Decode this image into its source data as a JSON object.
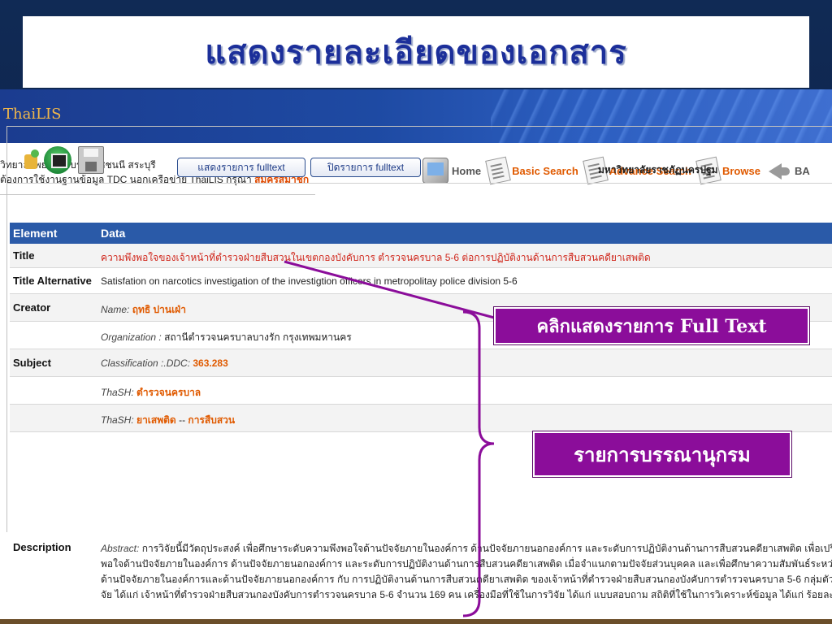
{
  "slide": {
    "title": "แสดงรายละเอียดของเอกสาร"
  },
  "app": {
    "logo": "ThaiLIS",
    "info_line1": "วิทยาลัยพยาบาลบรมราชชนนี สระบุรี",
    "info_line2_prefix": "ต้องการใช้งานฐานข้อมูล TDC นอกเครือข่าย ThaiLIS กรุณา",
    "info_line2_link": "สมัครสมาชิก"
  },
  "nav": {
    "home": "Home",
    "basic_search": "Basic Search",
    "advance_search": "Advance Search",
    "browse": "Browse",
    "back": "BA"
  },
  "toolbar": {
    "show_fulltext": "แสดงรายการ fulltext",
    "close_fulltext": "ปิดรายการ fulltext",
    "university": "มหาวิทยาลัยราชภัฏนครปฐม"
  },
  "table": {
    "col_element": "Element",
    "col_data": "Data",
    "title_label": "Title",
    "title_value": "ความพึงพอใจของเจ้าหน้าที่ตำรวจฝ่ายสืบสวนในเขตกองบังคับการ ตำรวจนครบาล 5-6 ต่อการปฏิบัติงานด้านการสืบสวนคดียาเสพติด",
    "title_alt_label": "Title Alternative",
    "title_alt_value": "Satisfation on narcotics investigation of the investigtion officers in metropolitay police division 5-6",
    "creator_label": "Creator",
    "creator_name_key": "Name:",
    "creator_name_value": "ฤทธิ ปานเฝ่า",
    "creator_org_key": "Organization :",
    "creator_org_value": "สถานีตำรวจนครบาลบางรัก กรุงเทพมหานคร",
    "subject_label": "Subject",
    "subject_class_key": "Classification :.DDC:",
    "subject_class_value": "363.283",
    "subject_thash1_key": "ThaSH:",
    "subject_thash1_value": "ตำรวจนครบาล",
    "subject_thash2_key": "ThaSH:",
    "subject_thash2_value_a": "ยาเสพติด",
    "subject_thash2_sep": "--",
    "subject_thash2_value_b": "การสืบสวน",
    "desc_label": "Description",
    "desc_key": "Abstract:",
    "desc_line1": "การวิจัยนี้มีวัตถุประสงค์ เพื่อศึกษาระดับความพึงพอใจด้านปัจจัยภายในองค์การ ด้านปัจจัยภายนอกองค์การ และระดับการปฏิบัติงานด้านการสืบสวนคดียาเสพติด เพื่อเปรียบเ",
    "desc_line2": "พอใจด้านปัจจัยภายในองค์การ ด้านปัจจัยภายนอกองค์การ และระดับการปฏิบัติงานด้านการสืบสวนคดียาเสพติด เมื่อจำแนกตามปัจจัยส่วนบุคคล และเพื่อศึกษาความสัมพันธ์ระหว่างคว",
    "desc_line3": "ด้านปัจจัยภายในองค์การและด้านปัจจัยภายนอกองค์การ กับ การปฏิบัติงานด้านการสืบสวนคดียาเสพติด ของเจ้าหน้าที่ตำรวจฝ่ายสืบสวนกองบังคับการตำรวจนครบาล 5-6 กลุ่มตัวอย่าง",
    "desc_line4": "จัย ได้แก่ เจ้าหน้าที่ตำรวจฝ่ายสืบสวนกองบังคับการตำรวจนครบาล 5-6 จำนวน 169 คน เครื่องมือที่ใช้ในการวิจัย ได้แก่ แบบสอบถาม สถิติที่ใช้ในการวิเคราะห์ข้อมูล ได้แก่ ร้อยละ ค่า"
  },
  "annotations": {
    "fulltext_callout": "คลิกแสดงรายการ Full Text",
    "bib_callout": "รายการบรรณานุกรม"
  },
  "colors": {
    "callout": "#8b0d9a",
    "table_header": "#2a5aa8",
    "title_text": "#1c2f9a",
    "link_orange": "#e05a00"
  }
}
